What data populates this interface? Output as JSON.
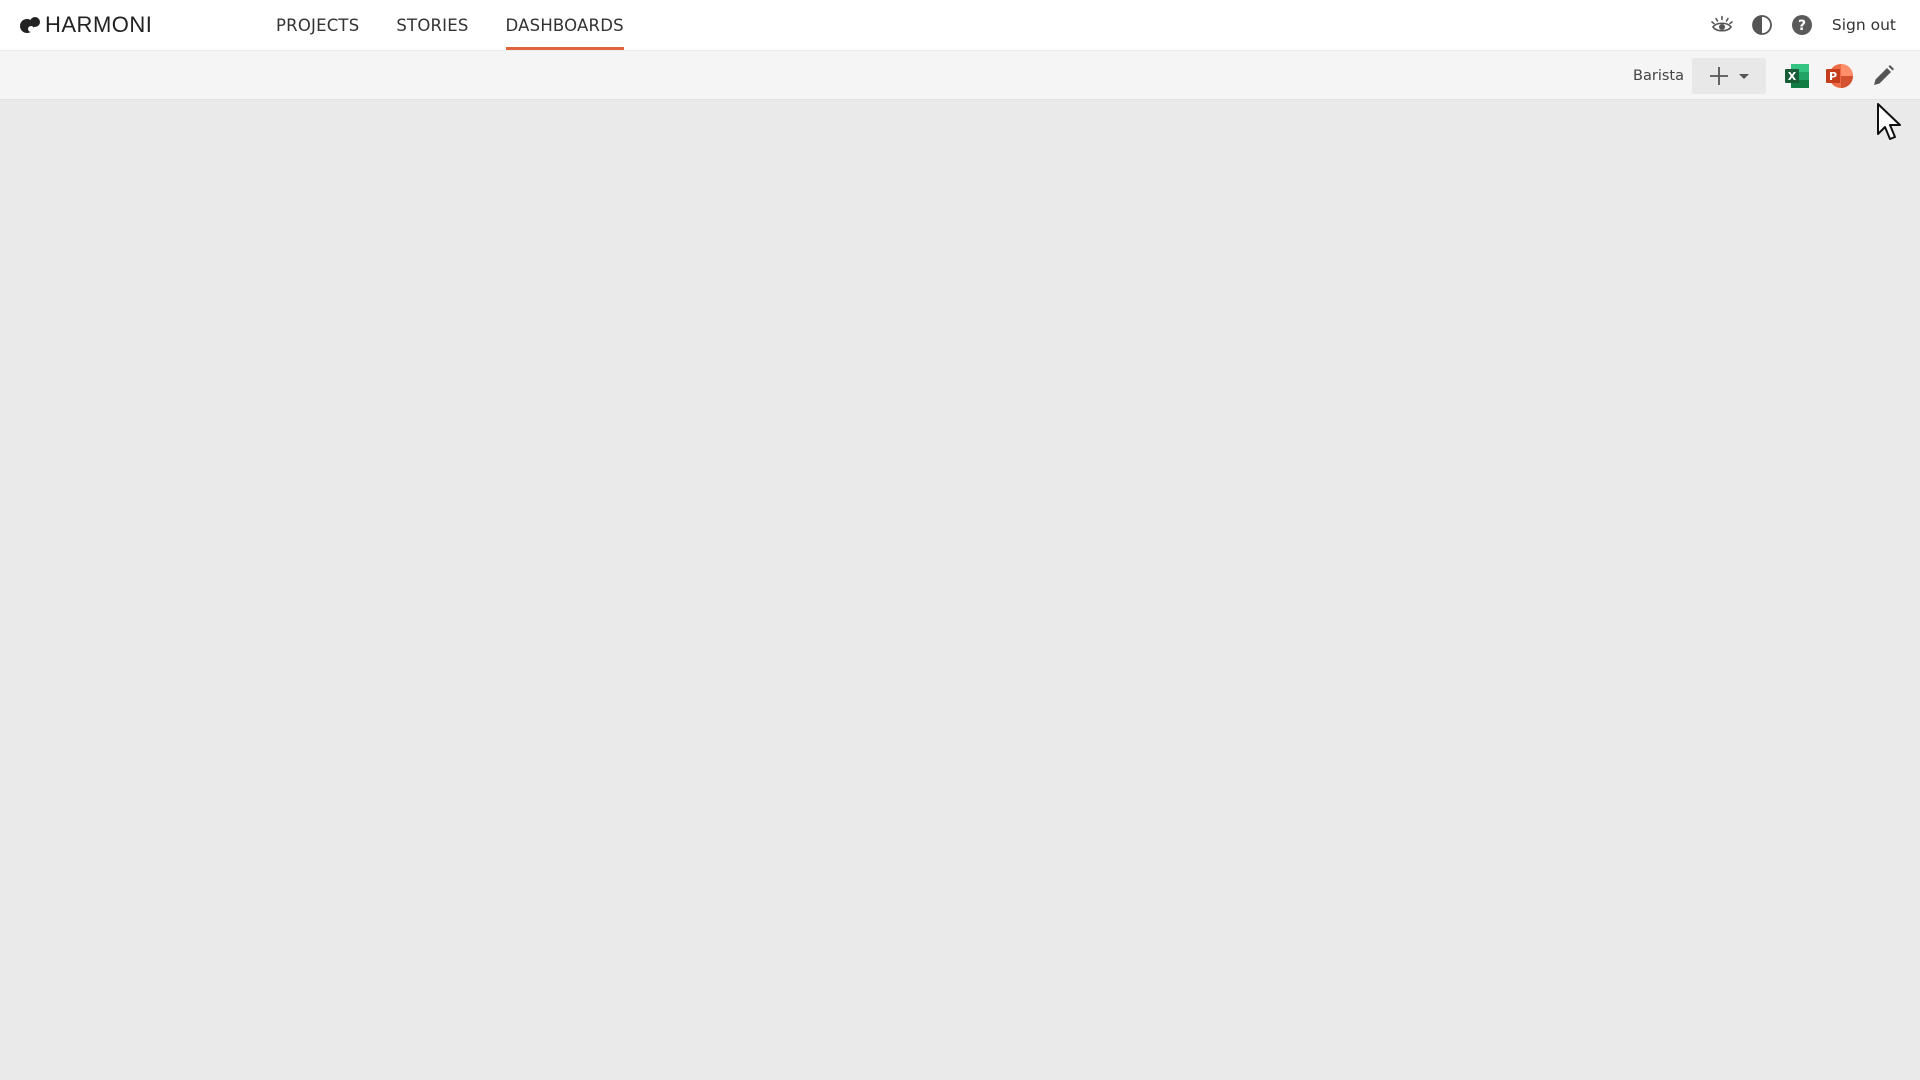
{
  "brand": {
    "name": "HARMONI"
  },
  "nav": {
    "tabs": [
      {
        "label": "PROJECTS",
        "active": false
      },
      {
        "label": "STORIES",
        "active": false
      },
      {
        "label": "DASHBOARDS",
        "active": true
      }
    ]
  },
  "header_actions": {
    "icons": [
      "preview-eye-icon",
      "contrast-icon",
      "help-icon"
    ],
    "signout_label": "Sign out"
  },
  "toolbar": {
    "workspace_label": "Barista",
    "add_menu_icons": [
      "plus-icon",
      "caret-down-icon"
    ],
    "export_icons": [
      "excel-icon",
      "powerpoint-icon"
    ],
    "edit_icon": "pencil-icon"
  },
  "colors": {
    "accent": "#e0633b",
    "topbar_bg": "#ffffff",
    "toolbar_bg": "#f5f5f5",
    "canvas_bg": "#eaeaeb",
    "excel_green": "#1e7145",
    "powerpoint_red": "#d24726"
  }
}
